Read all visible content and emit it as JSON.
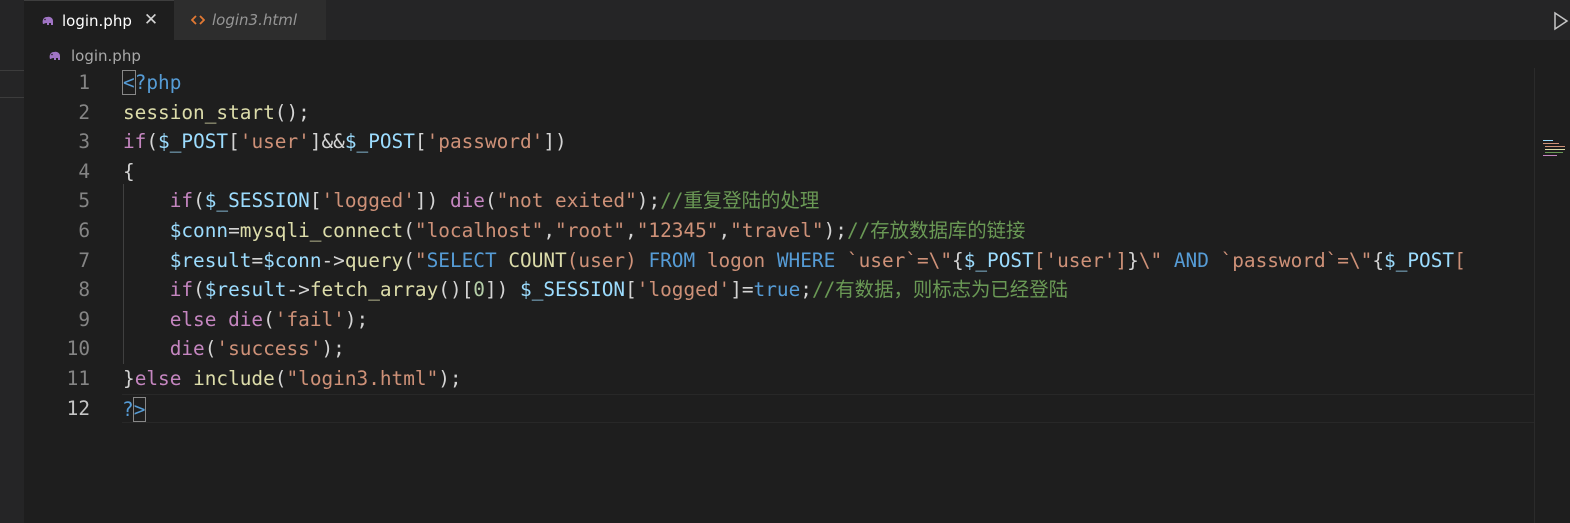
{
  "tabs": [
    {
      "label": "login.php",
      "icon": "php-elephant-icon",
      "active": true
    },
    {
      "label": "login3.html",
      "icon": "html-code-icon",
      "active": false
    }
  ],
  "tab_close_glyph": "✕",
  "breadcrumb": {
    "label": "login.php",
    "icon": "php-elephant-icon"
  },
  "colors": {
    "php_icon": "#a074c4",
    "html_icon": "#e37933",
    "background": "#1e1e1e"
  },
  "line_numbers": [
    "1",
    "2",
    "3",
    "4",
    "5",
    "6",
    "7",
    "8",
    "9",
    "10",
    "11",
    "12"
  ],
  "current_line": 12,
  "code_lines": [
    [
      [
        "tag",
        "<"
      ],
      [
        "tag",
        "?php"
      ]
    ],
    [
      [
        "fn",
        "session_start"
      ],
      [
        "plain",
        "();"
      ]
    ],
    [
      [
        "kw",
        "if"
      ],
      [
        "plain",
        "("
      ],
      [
        "var",
        "$_POST"
      ],
      [
        "plain",
        "["
      ],
      [
        "str",
        "'user'"
      ],
      [
        "plain",
        "]&&"
      ],
      [
        "var",
        "$_POST"
      ],
      [
        "plain",
        "["
      ],
      [
        "str",
        "'password'"
      ],
      [
        "plain",
        "])"
      ]
    ],
    [
      [
        "plain",
        "{"
      ]
    ],
    [
      [
        "plain",
        "    "
      ],
      [
        "kw",
        "if"
      ],
      [
        "plain",
        "("
      ],
      [
        "var",
        "$_SESSION"
      ],
      [
        "plain",
        "["
      ],
      [
        "str",
        "'logged'"
      ],
      [
        "plain",
        "]) "
      ],
      [
        "kw",
        "die"
      ],
      [
        "plain",
        "("
      ],
      [
        "str",
        "\"not exited\""
      ],
      [
        "plain",
        ");"
      ],
      [
        "cmt",
        "//重复登陆的处理"
      ]
    ],
    [
      [
        "plain",
        "    "
      ],
      [
        "var",
        "$conn"
      ],
      [
        "plain",
        "="
      ],
      [
        "fn",
        "mysqli_connect"
      ],
      [
        "plain",
        "("
      ],
      [
        "str",
        "\"localhost\""
      ],
      [
        "plain",
        ","
      ],
      [
        "str",
        "\"root\""
      ],
      [
        "plain",
        ","
      ],
      [
        "str",
        "\"12345\""
      ],
      [
        "plain",
        ","
      ],
      [
        "str",
        "\"travel\""
      ],
      [
        "plain",
        ");"
      ],
      [
        "cmt",
        "//存放数据库的链接"
      ]
    ],
    [
      [
        "plain",
        "    "
      ],
      [
        "var",
        "$result"
      ],
      [
        "plain",
        "="
      ],
      [
        "var",
        "$conn"
      ],
      [
        "plain",
        "->"
      ],
      [
        "fn",
        "query"
      ],
      [
        "plain",
        "("
      ],
      [
        "str",
        "\""
      ],
      [
        "sqlkw",
        "SELECT "
      ],
      [
        "fn",
        "COUNT"
      ],
      [
        "str",
        "(user) "
      ],
      [
        "sqlkw",
        "FROM "
      ],
      [
        "str",
        "logon "
      ],
      [
        "sqlkw",
        "WHERE "
      ],
      [
        "str",
        "`user`=\\\""
      ],
      [
        "plain",
        "{"
      ],
      [
        "var",
        "$_POST"
      ],
      [
        "str",
        "['user']"
      ],
      [
        "plain",
        "}"
      ],
      [
        "str",
        "\\\" "
      ],
      [
        "sqlkw",
        "AND "
      ],
      [
        "str",
        "`password`=\\\""
      ],
      [
        "plain",
        "{"
      ],
      [
        "var",
        "$_POST"
      ],
      [
        "str",
        "["
      ]
    ],
    [
      [
        "plain",
        "    "
      ],
      [
        "kw",
        "if"
      ],
      [
        "plain",
        "("
      ],
      [
        "var",
        "$result"
      ],
      [
        "plain",
        "->"
      ],
      [
        "fn",
        "fetch_array"
      ],
      [
        "plain",
        "()["
      ],
      [
        "num",
        "0"
      ],
      [
        "plain",
        "]) "
      ],
      [
        "var",
        "$_SESSION"
      ],
      [
        "plain",
        "["
      ],
      [
        "str",
        "'logged'"
      ],
      [
        "plain",
        "]="
      ],
      [
        "bool",
        "true"
      ],
      [
        "plain",
        ";"
      ],
      [
        "cmt",
        "//有数据，则标志为已经登陆"
      ]
    ],
    [
      [
        "plain",
        "    "
      ],
      [
        "kw",
        "else "
      ],
      [
        "kw",
        "die"
      ],
      [
        "plain",
        "("
      ],
      [
        "str",
        "'fail'"
      ],
      [
        "plain",
        ");"
      ]
    ],
    [
      [
        "plain",
        "    "
      ],
      [
        "kw",
        "die"
      ],
      [
        "plain",
        "("
      ],
      [
        "str",
        "'success'"
      ],
      [
        "plain",
        ");"
      ]
    ],
    [
      [
        "plain",
        "}"
      ],
      [
        "kw",
        "else "
      ],
      [
        "fn",
        "include"
      ],
      [
        "plain",
        "("
      ],
      [
        "str",
        "\"login3.html\""
      ],
      [
        "plain",
        ");"
      ]
    ],
    [
      [
        "tag",
        "?"
      ],
      [
        "tag",
        ">"
      ]
    ]
  ]
}
